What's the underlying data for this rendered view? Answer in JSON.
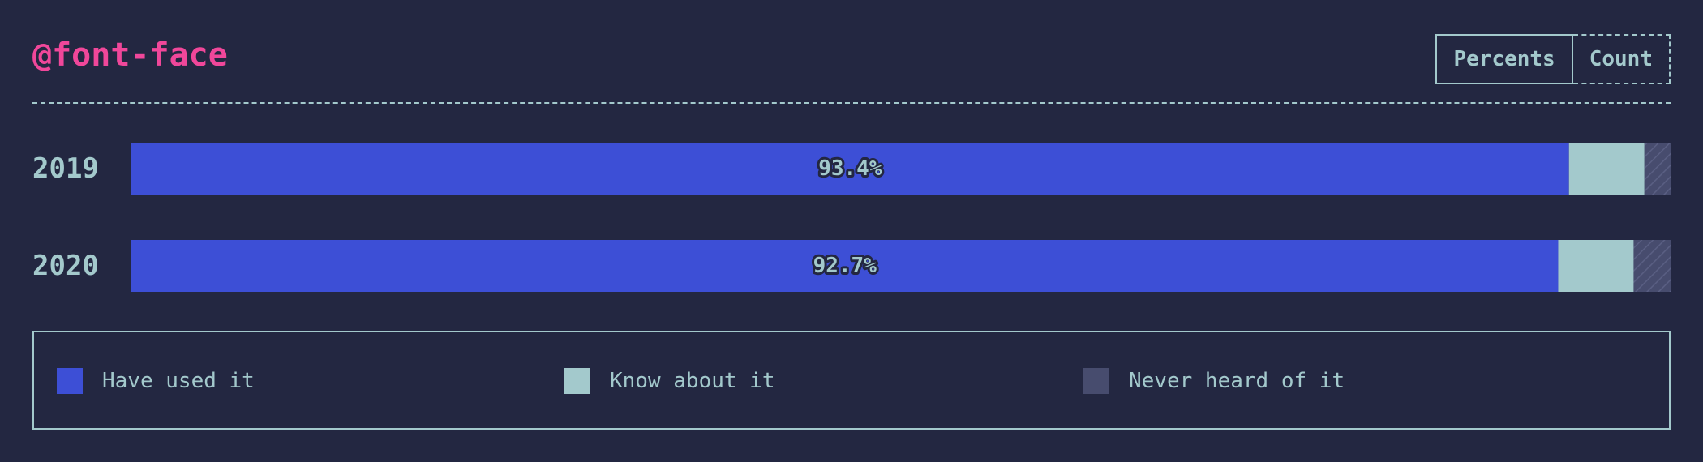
{
  "header": {
    "title": "@font-face"
  },
  "toggle": {
    "percents_label": "Percents",
    "count_label": "Count",
    "active": "percents"
  },
  "colors": {
    "background": "#232741",
    "title": "#f0479a",
    "text": "#a3c9cc",
    "have_used_it": "#3d4fd6",
    "know_about_it": "#a3c9cc",
    "never_heard_of_it": "#474c6e"
  },
  "chart_data": {
    "type": "bar",
    "orientation": "horizontal",
    "stacked": true,
    "categories": [
      "2019",
      "2020"
    ],
    "series": [
      {
        "name": "Have used it",
        "values": [
          93.4,
          92.7
        ]
      },
      {
        "name": "Know about it",
        "values": [
          4.9,
          4.9
        ]
      },
      {
        "name": "Never heard of it",
        "values": [
          1.7,
          2.4
        ]
      }
    ],
    "data_labels": [
      "93.4%",
      "92.7%"
    ],
    "xlim": [
      0,
      100
    ],
    "grid": false,
    "legend_position": "bottom"
  },
  "legend": {
    "items": [
      {
        "label": "Have used it",
        "color": "#3d4fd6"
      },
      {
        "label": "Know about it",
        "color": "#a3c9cc"
      },
      {
        "label": "Never heard of it",
        "color": "#474c6e"
      }
    ]
  }
}
